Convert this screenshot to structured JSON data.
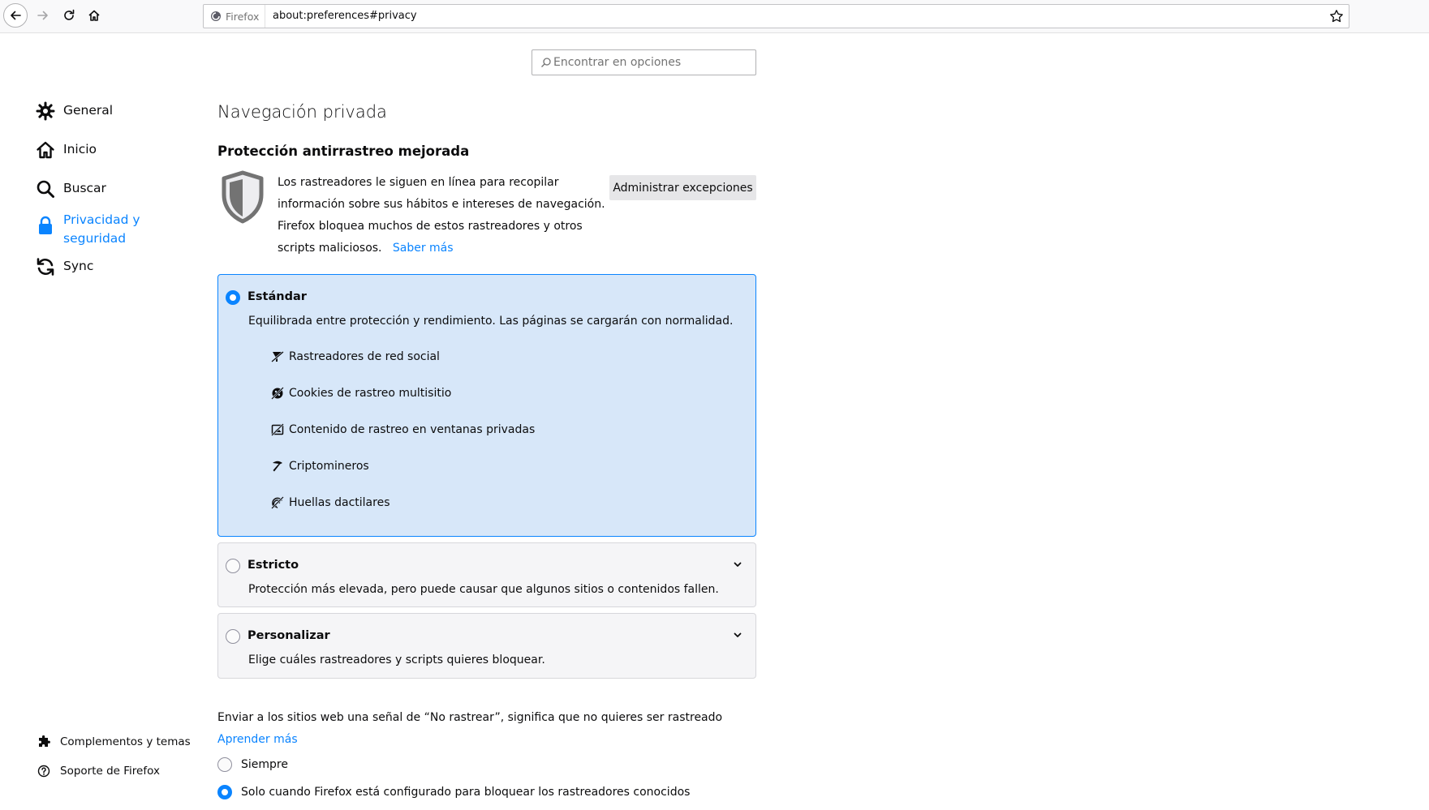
{
  "toolbar": {
    "identity_label": "Firefox",
    "url": "about:preferences#privacy"
  },
  "search": {
    "placeholder": "Encontrar en opciones"
  },
  "sidebar": {
    "items": [
      {
        "label": "General",
        "icon": "gear-icon"
      },
      {
        "label": "Inicio",
        "icon": "home-icon"
      },
      {
        "label": "Buscar",
        "icon": "search-icon"
      },
      {
        "label_line1": "Privacidad y",
        "label_line2": "seguridad",
        "icon": "lock-icon",
        "selected": true
      },
      {
        "label": "Sync",
        "icon": "sync-icon"
      }
    ],
    "footer": [
      {
        "label": "Complementos y temas",
        "icon": "puzzle-icon"
      },
      {
        "label": "Soporte de Firefox",
        "icon": "help-icon"
      }
    ]
  },
  "main": {
    "title": "Navegación privada",
    "etp": {
      "heading": "Protección antirrastreo mejorada",
      "description": "Los rastreadores le siguen en línea para recopilar información sobre sus hábitos e intereses de navegación. Firefox bloquea muchos de estos rastreadores y otros scripts maliciosos.",
      "learn_more": "Saber más",
      "manage_button": "Administrar excepciones"
    },
    "options": {
      "standard": {
        "title": "Estándar",
        "description": "Equilibrada entre protección y rendimiento. Las páginas se cargarán con normalidad.",
        "selected": true,
        "features": [
          {
            "label": "Rastreadores de red social",
            "icon": "social-tracker-icon"
          },
          {
            "label": "Cookies de rastreo multisitio",
            "icon": "cookie-icon"
          },
          {
            "label": "Contenido de rastreo en ventanas privadas",
            "icon": "tracking-content-icon"
          },
          {
            "label": "Criptomineros",
            "icon": "cryptominer-icon"
          },
          {
            "label": "Huellas dactilares",
            "icon": "fingerprinter-icon"
          }
        ]
      },
      "strict": {
        "title": "Estricto",
        "description": "Protección más elevada, pero puede causar que algunos sitios o contenidos fallen.",
        "selected": false
      },
      "custom": {
        "title": "Personalizar",
        "description": "Elige cuáles rastreadores y scripts quieres bloquear.",
        "selected": false
      }
    },
    "dnt": {
      "text": "Enviar a los sitios web una señal de “No rastrear”, significa que no quieres ser rastreado",
      "learn_more": "Aprender más",
      "always": "Siempre",
      "only_when": "Solo cuando Firefox está configurado para bloquear los rastreadores conocidos",
      "selected": "only_when"
    }
  },
  "colors": {
    "accent": "#0a84ff",
    "selected_option_bg": "#d7e7f9"
  }
}
